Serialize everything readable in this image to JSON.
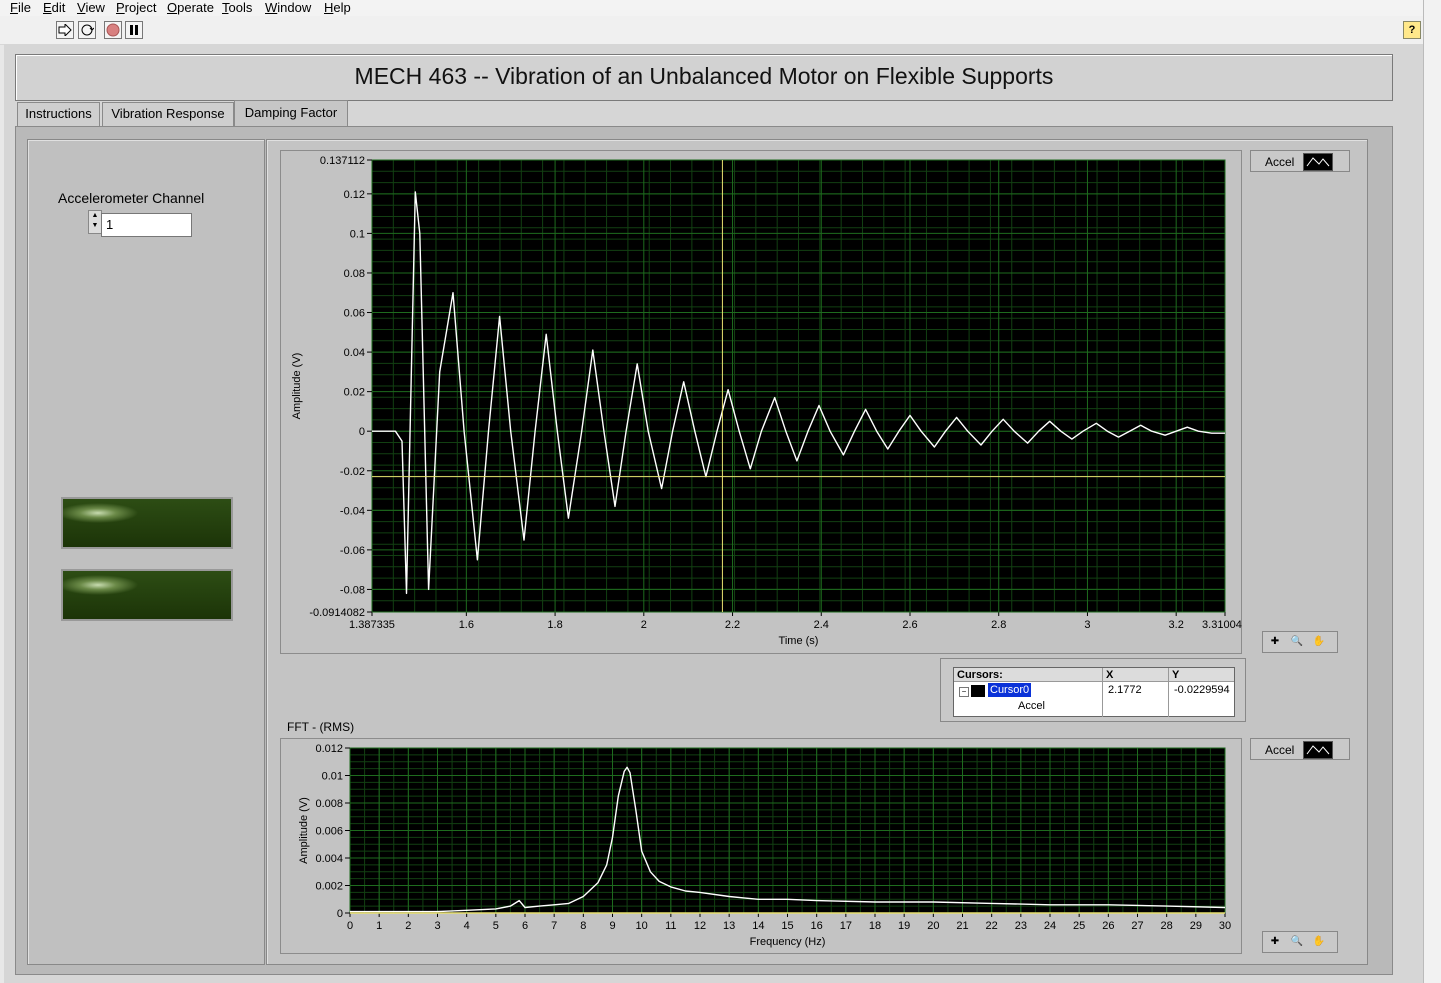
{
  "menu": [
    "File",
    "Edit",
    "View",
    "Project",
    "Operate",
    "Tools",
    "Window",
    "Help"
  ],
  "menu_mnemonics": [
    "F",
    "E",
    "V",
    "P",
    "O",
    "T",
    "W",
    "H"
  ],
  "help_button": "?",
  "title": "MECH 463 -- Vibration of an Unbalanced Motor on Flexible Supports",
  "tabs": [
    "Instructions",
    "Vibration Response",
    "Damping Factor"
  ],
  "active_tab": "Damping Factor",
  "channel": {
    "label": "Accelerometer Channel",
    "value": "1"
  },
  "indicators": [
    {
      "state": "off",
      "color": "#2d4d14"
    },
    {
      "state": "off",
      "color": "#2d4d14"
    }
  ],
  "time_plot": {
    "legend": "Accel",
    "cursor_header": "Cursors:",
    "x_header": "X",
    "y_header": "Y",
    "cursor_name": "Cursor0",
    "cursor_plot": "Accel",
    "cursor_x": "2.1772",
    "cursor_y": "-0.0229594"
  },
  "fft_plot": {
    "label": "FFT - (RMS)",
    "legend": "Accel"
  },
  "chart_data": [
    {
      "type": "line",
      "title": "",
      "xlabel": "Time (s)",
      "ylabel": "Amplitude (V)",
      "xlim": [
        1.387335,
        3.310042
      ],
      "ylim": [
        -0.0914082,
        0.137112
      ],
      "x_ticks": [
        "1.387335",
        "1.6",
        "1.8",
        "2",
        "2.2",
        "2.4",
        "2.6",
        "2.8",
        "3",
        "3.2",
        "3.310042"
      ],
      "y_ticks": [
        "0.137112",
        "0.12",
        "0.1",
        "0.08",
        "0.06",
        "0.04",
        "0.02",
        "0",
        "-0.02",
        "-0.04",
        "-0.06",
        "-0.08",
        "-0.0914082"
      ],
      "cursor": {
        "x": 2.1772,
        "y": -0.0229594,
        "color": "#e8e070"
      },
      "grid": true,
      "background": "#000000",
      "grid_color": "#1e6b1e",
      "series": [
        {
          "name": "Accel",
          "color": "#ffffff",
          "x": [
            1.387,
            1.44,
            1.455,
            1.465,
            1.485,
            1.495,
            1.515,
            1.54,
            1.57,
            1.595,
            1.625,
            1.65,
            1.675,
            1.7,
            1.73,
            1.755,
            1.78,
            1.805,
            1.83,
            1.86,
            1.885,
            1.91,
            1.935,
            1.96,
            1.985,
            2.01,
            2.04,
            2.065,
            2.09,
            2.115,
            2.14,
            2.165,
            2.19,
            2.215,
            2.24,
            2.265,
            2.295,
            2.32,
            2.345,
            2.37,
            2.395,
            2.42,
            2.45,
            2.475,
            2.5,
            2.525,
            2.55,
            2.575,
            2.6,
            2.625,
            2.655,
            2.68,
            2.705,
            2.73,
            2.76,
            2.785,
            2.81,
            2.835,
            2.865,
            2.89,
            2.915,
            2.94,
            2.965,
            2.99,
            3.02,
            3.045,
            3.07,
            3.095,
            3.12,
            3.145,
            3.175,
            3.2,
            3.225,
            3.25,
            3.28,
            3.31
          ],
          "y": [
            0.0,
            0.0,
            -0.005,
            -0.082,
            0.121,
            0.1,
            -0.08,
            0.03,
            0.07,
            0.0,
            -0.065,
            0.0,
            0.058,
            0.0,
            -0.055,
            0.0,
            0.049,
            0.0,
            -0.044,
            0.0,
            0.041,
            0.0,
            -0.038,
            0.0,
            0.034,
            0.0,
            -0.029,
            0.0,
            0.025,
            0.0,
            -0.023,
            0.0,
            0.021,
            0.0,
            -0.019,
            0.0,
            0.017,
            0.0,
            -0.015,
            0.0,
            0.013,
            0.0,
            -0.012,
            0.0,
            0.011,
            0.0,
            -0.009,
            0.0,
            0.008,
            0.0,
            -0.008,
            0.0,
            0.007,
            0.0,
            -0.007,
            0.0,
            0.006,
            0.0,
            -0.006,
            0.0,
            0.005,
            0.0,
            -0.004,
            0.0,
            0.004,
            0.0,
            -0.003,
            0.0,
            0.003,
            0.0,
            -0.002,
            0.0,
            0.002,
            0.0,
            -0.001,
            -0.001
          ]
        }
      ]
    },
    {
      "type": "line",
      "title": "FFT - (RMS)",
      "xlabel": "Frequency (Hz)",
      "ylabel": "Amplitude (V)",
      "xlim": [
        0,
        30
      ],
      "ylim": [
        0,
        0.012
      ],
      "x_ticks": [
        "0",
        "1",
        "2",
        "3",
        "4",
        "5",
        "6",
        "7",
        "8",
        "9",
        "10",
        "11",
        "12",
        "13",
        "14",
        "15",
        "16",
        "17",
        "18",
        "19",
        "20",
        "21",
        "22",
        "23",
        "24",
        "25",
        "26",
        "27",
        "28",
        "29",
        "30"
      ],
      "y_ticks": [
        "0.012",
        "0.01",
        "0.008",
        "0.006",
        "0.004",
        "0.002",
        "0"
      ],
      "grid": true,
      "background": "#000000",
      "grid_color": "#1e6b1e",
      "series": [
        {
          "name": "Accel",
          "color": "#ffffff",
          "x": [
            0,
            1,
            2,
            3,
            4,
            5,
            5.5,
            5.8,
            6.0,
            6.5,
            7,
            7.5,
            8,
            8.5,
            8.8,
            9.0,
            9.2,
            9.4,
            9.5,
            9.6,
            9.8,
            10.0,
            10.3,
            10.6,
            11,
            11.5,
            12,
            13,
            13.5,
            14,
            15,
            16,
            18,
            20,
            22,
            24,
            26,
            28,
            30
          ],
          "y": [
            0.0001,
            0.0001,
            0.0001,
            0.0001,
            0.0002,
            0.0003,
            0.0005,
            0.0009,
            0.0004,
            0.0005,
            0.0006,
            0.0007,
            0.0012,
            0.0022,
            0.0035,
            0.0055,
            0.0085,
            0.0103,
            0.0106,
            0.0102,
            0.0075,
            0.0045,
            0.003,
            0.0023,
            0.0019,
            0.0016,
            0.0015,
            0.0012,
            0.0011,
            0.001,
            0.001,
            0.0009,
            0.0008,
            0.0008,
            0.0007,
            0.0006,
            0.0006,
            0.0005,
            0.0004
          ]
        },
        {
          "name": "baseline",
          "color": "#e8e070",
          "x": [
            0,
            30
          ],
          "y": [
            0.0,
            0.0
          ]
        }
      ]
    }
  ]
}
